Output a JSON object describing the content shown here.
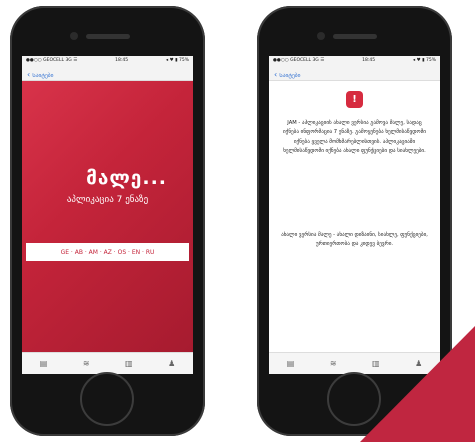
{
  "left_phone": {
    "status": {
      "carrier": "●●○○ GEOCELL 3G ☰",
      "time": "18:45",
      "battery": "◂ ♥ ▮ 75%"
    },
    "nav": {
      "back_label": "Საიტები"
    },
    "splash": {
      "title": "მალე...",
      "subtitle": "აპლიკაცია 7 ენაზე",
      "languages": "GE · AB · AM · AZ · OS · EN · RU"
    },
    "tabs": [
      {
        "icon": "▤",
        "name": "tab-news"
      },
      {
        "icon": "≋",
        "name": "tab-feed"
      },
      {
        "icon": "▥",
        "name": "tab-stats"
      },
      {
        "icon": "♟",
        "name": "tab-profile"
      }
    ]
  },
  "right_phone": {
    "status": {
      "carrier": "●●○○ GEOCELL 3G ☰",
      "time": "18:45",
      "battery": "◂ ♥ ▮ 75%"
    },
    "nav": {
      "back_label": "Საიტები"
    },
    "logo": "!",
    "paragraph1": "JAM - აპლიკაციის ახალი ვერსია გამოვა მალე, სადაც იქნება ინფორმაცია 7 ენაზე. გამოყენება ხელმისაწვდომი იქნება ყველა მომხმარებლისთვის. აპლიკაციაში ხელმისაწვდომი იქნება ახალი ფუნქციები და სიახლეები.",
    "paragraph2": "ახალი ვერსია მალე - ახალი დიზაინი, სიახლე, ფუნქციები, ურთიერთობა და კიდევ ბევრი.",
    "tabs": [
      {
        "icon": "▤",
        "name": "tab-news"
      },
      {
        "icon": "≋",
        "name": "tab-feed"
      },
      {
        "icon": "▥",
        "name": "tab-stats"
      },
      {
        "icon": "♟",
        "name": "tab-profile"
      }
    ]
  },
  "colors": {
    "brand_red": "#c4243a",
    "corner_red": "#c02640",
    "ios_blue": "#2f6fd1"
  }
}
